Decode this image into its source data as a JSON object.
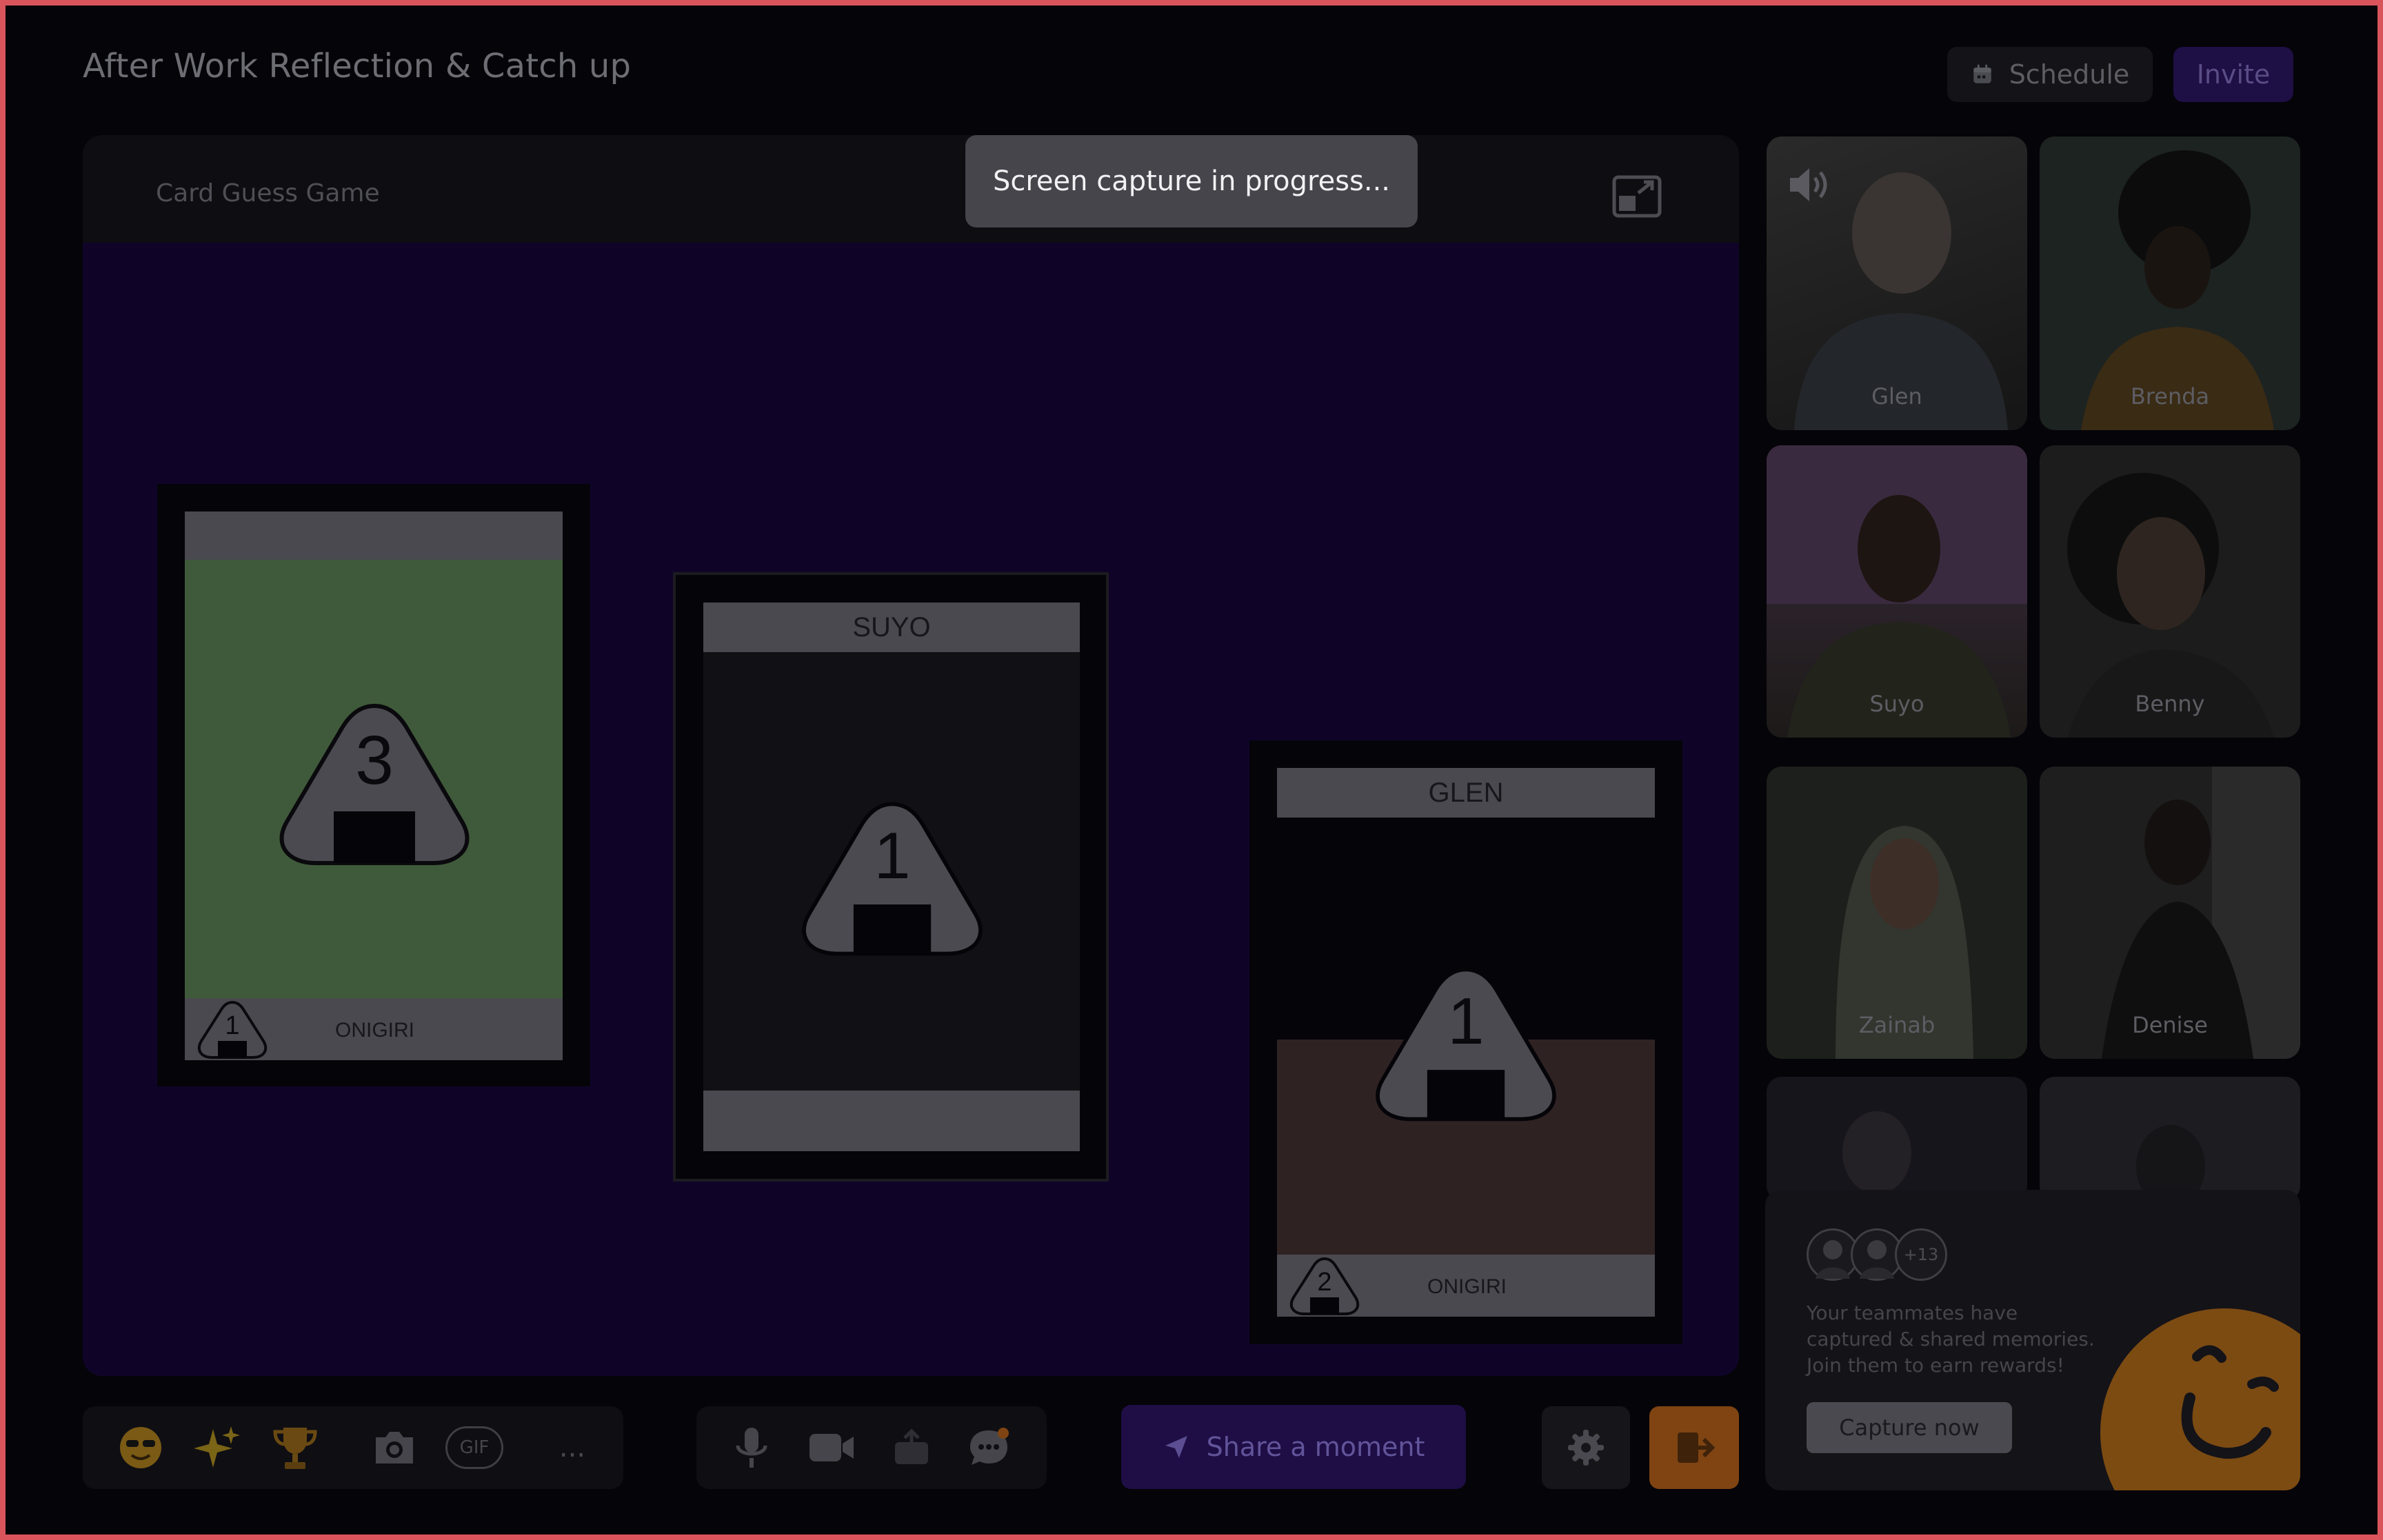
{
  "meeting": {
    "title": "After Work Reflection & Catch up"
  },
  "header": {
    "schedule_label": "Schedule",
    "invite_label": "Invite"
  },
  "stage": {
    "game_title": "Card Guess Game",
    "toast": "Screen capture in progress..."
  },
  "cards": [
    {
      "top_label": "",
      "number": "3",
      "badge_number": "1",
      "footer_label": "ONIGIRI",
      "fill": "#3f5a3a"
    },
    {
      "top_label": "SUYO",
      "number": "1",
      "badge_number": "",
      "footer_label": "",
      "fill": "#111014"
    },
    {
      "top_label": "GLEN",
      "number": "1",
      "badge_number": "2",
      "footer_label": "ONIGIRI",
      "fill": "#2f2222"
    }
  ],
  "participants": [
    {
      "name": "Glen"
    },
    {
      "name": "Brenda"
    },
    {
      "name": "Suyo"
    },
    {
      "name": "Benny"
    },
    {
      "name": "Zainab"
    },
    {
      "name": "Denise"
    }
  ],
  "promo": {
    "avatar_more": "+13",
    "text": "Your teammates have captured & shared memories. Join them to earn rewards!",
    "button_label": "Capture now"
  },
  "toolbar": {
    "gif_label": "GIF",
    "more_label": "...",
    "share_label": "Share a moment"
  },
  "colors": {
    "accent": "#1e0e45",
    "board": "#0f0428",
    "leave": "#7f4412",
    "frame": "#d9545b"
  }
}
